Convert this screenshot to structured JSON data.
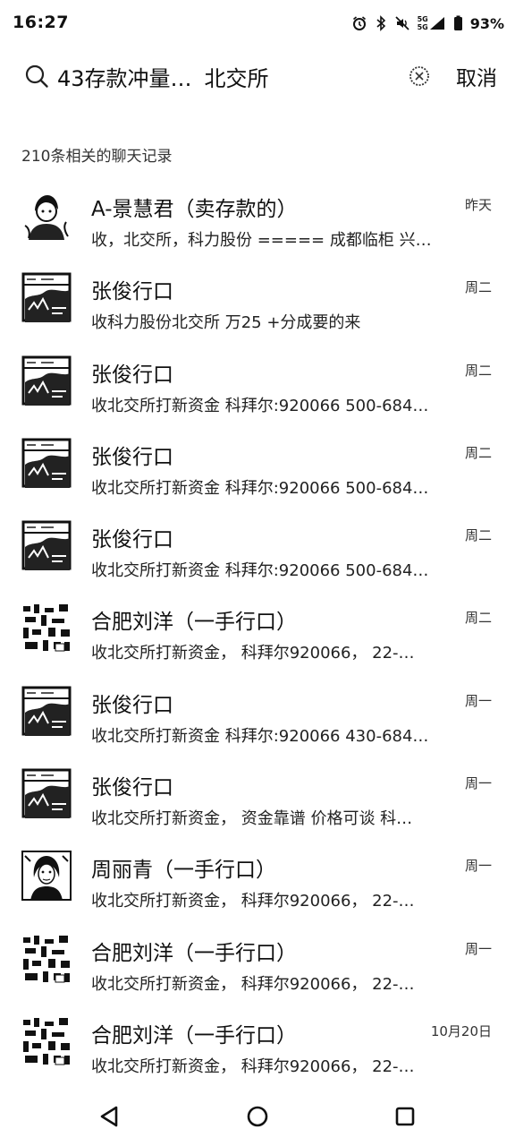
{
  "status_bar": {
    "time": "16:27",
    "network_top": "5G",
    "network_bottom": "5G",
    "battery": "93%",
    "icons": [
      "alarm-icon",
      "bluetooth-icon",
      "mute-icon",
      "signal-icon",
      "battery-icon"
    ]
  },
  "search": {
    "query_part1": "43存款冲量…",
    "query_part2": "北交所",
    "cancel_label": "取消"
  },
  "results_count": "210条相关的聊天记录",
  "results": [
    {
      "name": "A-景慧君（卖存款的）",
      "snippet": "收，北交所，科力股份  =====  成都临柜 兴…",
      "date": "昨天",
      "avatar": "portrait"
    },
    {
      "name": "张俊行口",
      "snippet": "收科力股份北交所 万25 +分成要的来",
      "date": "周二",
      "avatar": "landscape"
    },
    {
      "name": "张俊行口",
      "snippet": "收北交所打新资金 科拜尔:920066 500-684…",
      "date": "周二",
      "avatar": "landscape"
    },
    {
      "name": "张俊行口",
      "snippet": "收北交所打新资金 科拜尔:920066 500-684…",
      "date": "周二",
      "avatar": "landscape"
    },
    {
      "name": "张俊行口",
      "snippet": "收北交所打新资金 科拜尔:920066 500-684…",
      "date": "周二",
      "avatar": "landscape"
    },
    {
      "name": "合肥刘洋（一手行口）",
      "snippet": "收北交所打新资金，  科拜尔920066，  22-…",
      "date": "周二",
      "avatar": "texture"
    },
    {
      "name": "张俊行口",
      "snippet": "收北交所打新资金 科拜尔:920066 430-684…",
      "date": "周一",
      "avatar": "landscape"
    },
    {
      "name": "张俊行口",
      "snippet": "收北交所打新资金，  资金靠谱 价格可谈  科…",
      "date": "周一",
      "avatar": "landscape"
    },
    {
      "name": "周丽青（一手行口）",
      "snippet": "收北交所打新资金，  科拜尔920066，  22-…",
      "date": "周一",
      "avatar": "woman"
    },
    {
      "name": "合肥刘洋（一手行口）",
      "snippet": "收北交所打新资金，  科拜尔920066，  22-…",
      "date": "周一",
      "avatar": "texture"
    },
    {
      "name": "合肥刘洋（一手行口）",
      "snippet": "收北交所打新资金，  科拜尔920066，  22-…",
      "date": "10月20日",
      "avatar": "texture"
    }
  ],
  "nav": {
    "icons": [
      "back-triangle-icon",
      "home-circle-icon",
      "recents-square-icon"
    ]
  }
}
